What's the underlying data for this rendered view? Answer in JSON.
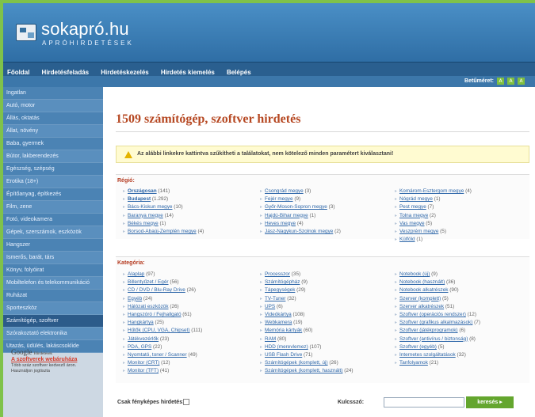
{
  "site": {
    "title": "sokapró.hu",
    "subtitle": "APRÓHIRDETÉSEK"
  },
  "nav": {
    "items": [
      "Főoldal",
      "Hirdetésfeladás",
      "Hirdetéskezelés",
      "Hirdetés kiemelés",
      "Belépés"
    ],
    "font_size_label": "Betűméret:",
    "font_size_buttons": [
      "A",
      "A",
      "A"
    ]
  },
  "sidebar": {
    "items": [
      "Ingatlan",
      "Autó, motor",
      "Állás, oktatás",
      "Állat, növény",
      "Baba, gyermek",
      "Bútor, lakberendezés",
      "Egészség, szépség",
      "Erotika (18+)",
      "Építőanyag, építkezés",
      "Film, zene",
      "Fotó, videokamera",
      "Gépek, szerszámok, eszközök",
      "Hangszer",
      "Ismerős, barát, társ",
      "Könyv, folyóirat",
      "Mobiltelefon és telekommunikáció",
      "Ruházat",
      "Sporteszköz",
      "Számítógép, szoftver",
      "Szórakoztató elektronika",
      "Utazás, üdülés, lakáscsoklide"
    ],
    "active_index": 18
  },
  "google_ad": {
    "brand": "Google",
    "label": "Hirdetések",
    "link": "A szoftverek webáruháza",
    "text": "Több száz szoftver kedvező áron. Használjon jogtiszta"
  },
  "main": {
    "heading": "1509 számítógép, szoftver hirdetés",
    "notice": "Az alábbi linkekre kattintva szűkítheti a találatokat, nem kötelező minden paramétert kiválasztani!",
    "region": {
      "title": "Régió:",
      "col1": [
        {
          "name": "Országosan",
          "count": "(141)",
          "bold": true
        },
        {
          "name": "Budapest",
          "count": "(1.292)",
          "bold": true
        },
        {
          "name": "Bács-Kiskun megye",
          "count": "(10)"
        },
        {
          "name": "Baranya megye",
          "count": "(14)"
        },
        {
          "name": "Békés megye",
          "count": "(1)"
        },
        {
          "name": "Borsod-Abaúj-Zemplén megye",
          "count": "(4)"
        }
      ],
      "col2": [
        {
          "name": "Csongrád megye",
          "count": "(3)"
        },
        {
          "name": "Fejér megye",
          "count": "(9)"
        },
        {
          "name": "Győr-Moson-Sopron megye",
          "count": "(3)"
        },
        {
          "name": "Hajdú-Bihar megye",
          "count": "(1)"
        },
        {
          "name": "Heves megye",
          "count": "(4)"
        },
        {
          "name": "Jász-Nagykun-Szolnok megye",
          "count": "(2)"
        }
      ],
      "col3": [
        {
          "name": "Komárom-Esztergom megye",
          "count": "(4)"
        },
        {
          "name": "Nógrád megye",
          "count": "(1)"
        },
        {
          "name": "Pest megye",
          "count": "(7)"
        },
        {
          "name": "Tolna megye",
          "count": "(2)"
        },
        {
          "name": "Vas megye",
          "count": "(5)"
        },
        {
          "name": "Veszprém megye",
          "count": "(5)"
        },
        {
          "name": "Külföld",
          "count": "(1)"
        }
      ]
    },
    "category": {
      "title": "Kategória:",
      "col1": [
        {
          "name": "Alaplap",
          "count": "(97)"
        },
        {
          "name": "Billentyűzet / Egér",
          "count": "(56)"
        },
        {
          "name": "CD / DVD / Blu-Ray Drive",
          "count": "(26)"
        },
        {
          "name": "Egyéb",
          "count": "(24)"
        },
        {
          "name": "Hálózati eszközök",
          "count": "(26)"
        },
        {
          "name": "Hangszóró / Fejhallgató",
          "count": "(61)"
        },
        {
          "name": "Hangkártya",
          "count": "(25)"
        },
        {
          "name": "Hűtők (CPU, VGA, Chipset)",
          "count": "(111)"
        },
        {
          "name": "Játékvezérlők",
          "count": "(23)"
        },
        {
          "name": "PDA, GPS",
          "count": "(22)"
        },
        {
          "name": "Nyomtató, toner / Scanner",
          "count": "(49)"
        },
        {
          "name": "Monitor (CRT)",
          "count": "(12)"
        },
        {
          "name": "Monitor (TFT)",
          "count": "(41)"
        }
      ],
      "col2": [
        {
          "name": "Processzor",
          "count": "(35)"
        },
        {
          "name": "Számítógépház",
          "count": "(9)"
        },
        {
          "name": "Tápegységek",
          "count": "(29)"
        },
        {
          "name": "TV-Tuner",
          "count": "(32)"
        },
        {
          "name": "UPS",
          "count": "(6)"
        },
        {
          "name": "Videókártya",
          "count": "(108)"
        },
        {
          "name": "Webkamera",
          "count": "(19)"
        },
        {
          "name": "Memória kártyák",
          "count": "(60)"
        },
        {
          "name": "RAM",
          "count": "(80)"
        },
        {
          "name": "HDD (merevlemez)",
          "count": "(107)"
        },
        {
          "name": "USB Flash Drive",
          "count": "(71)"
        },
        {
          "name": "Számítógépek (komplett, új)",
          "count": "(26)"
        },
        {
          "name": "Számítógépek (komplett, használt)",
          "count": "(24)"
        }
      ],
      "col3": [
        {
          "name": "Notebook (új)",
          "count": "(9)"
        },
        {
          "name": "Notebook (használt)",
          "count": "(36)"
        },
        {
          "name": "Notebook alkatrészek",
          "count": "(90)"
        },
        {
          "name": "Szerver (komplett)",
          "count": "(5)"
        },
        {
          "name": "Szerver alkatrészek",
          "count": "(51)"
        },
        {
          "name": "Szoftver (operációs rendszer)",
          "count": "(12)"
        },
        {
          "name": "Szoftver (grafikus alkalmazások)",
          "count": "(7)"
        },
        {
          "name": "Szoftver (játékprogramok)",
          "count": "(6)"
        },
        {
          "name": "Szoftver (antivírus / biztonság)",
          "count": "(8)"
        },
        {
          "name": "Szoftver (egyéb)",
          "count": "(5)"
        },
        {
          "name": "Internetes szolgáltatások",
          "count": "(32)"
        },
        {
          "name": "Tanfolyamok",
          "count": "(21)"
        }
      ]
    },
    "filters": {
      "photo_only_label": "Csak fényképes hirdetés:",
      "keyword_label": "Kulcsszó:",
      "keyword_value": "",
      "search_button": "keresés"
    }
  }
}
